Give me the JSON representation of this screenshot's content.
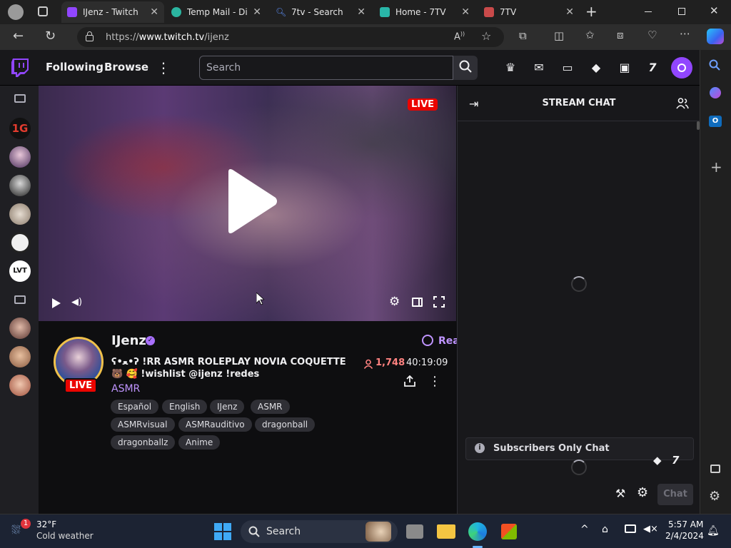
{
  "browser": {
    "tabs": [
      {
        "title": "IJenz - Twitch",
        "color": "#9146ff"
      },
      {
        "title": "Temp Mail - Di",
        "color": "#2bb5a0"
      },
      {
        "title": "7tv - Search",
        "color": "#3b6fe0"
      },
      {
        "title": "Home - 7TV",
        "color": "#29b6a8"
      },
      {
        "title": "7TV",
        "color": "#c94a4a"
      }
    ],
    "url_prefix": "https://",
    "url_host": "www.twitch.tv",
    "url_path": "/ijenz"
  },
  "twitch": {
    "nav": {
      "following": "Following",
      "browse": "Browse",
      "search_placeholder": "Search"
    },
    "video": {
      "live_badge": "LIVE"
    },
    "stream": {
      "channel": "IJenz",
      "title_line1": "ʕ•ﻌ•ʔ !RR ASMR ROLEPLAY NOVIA COQUETTE",
      "title_line2": "🐻 🥰 !wishlist @ijenz !redes",
      "category": "ASMR",
      "viewers": "1,748",
      "uptime": "40:19:09",
      "live_badge": "LIVE",
      "react_label": "Rea",
      "tags": [
        "Español",
        "English",
        "IJenz",
        "ASMR",
        "ASMRvisual",
        "ASMRauditivo",
        "dragonball",
        "dragonballz",
        "Anime"
      ]
    },
    "chat": {
      "header": "STREAM CHAT",
      "subscribers_only": "Subscribers Only Chat",
      "chat_button": "Chat"
    }
  },
  "taskbar": {
    "weather_temp": "32°F",
    "weather_desc": "Cold weather",
    "weather_badge": "1",
    "search_label": "Search",
    "time": "5:57 AM",
    "date": "2/4/2024"
  }
}
